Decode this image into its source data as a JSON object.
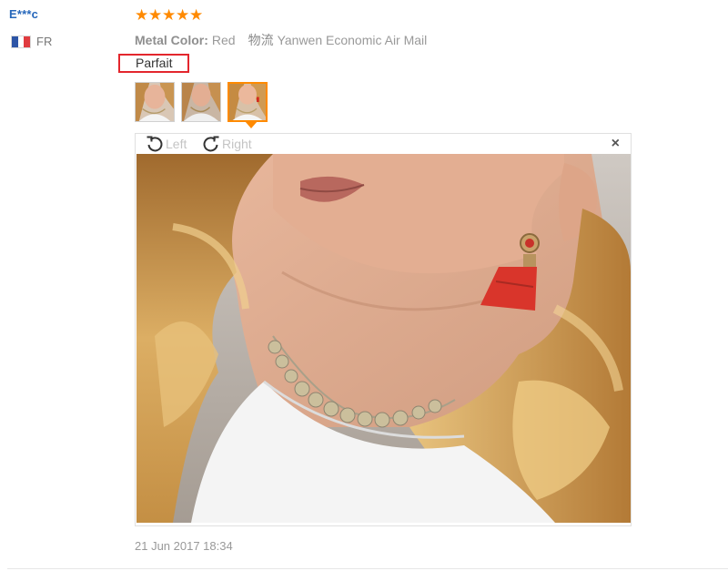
{
  "reviewer": {
    "name": "E***c",
    "country_code": "FR",
    "flag_icon": "france-flag-icon"
  },
  "review": {
    "rating_stars": 5,
    "rating_max": 5,
    "star_icon": "star-icon",
    "metal_color_label": "Metal Color:",
    "metal_color_value": "Red",
    "shipping_label": "物流",
    "shipping_value": "Yanwen Economic Air Mail",
    "feedback": "Parfait",
    "date": "21 Jun 2017 18:34"
  },
  "thumbnails": [
    {
      "name": "review-photo-thumb-1",
      "active": false
    },
    {
      "name": "review-photo-thumb-2",
      "active": false
    },
    {
      "name": "review-photo-thumb-3",
      "active": true
    }
  ],
  "viewer": {
    "rotate_left_label": "Left",
    "rotate_right_label": "Right",
    "close_label": "×",
    "rotate_left_icon": "rotate-left-icon",
    "rotate_right_icon": "rotate-right-icon",
    "close_icon": "close-icon"
  },
  "colors": {
    "accent_orange": "#ff8a00",
    "reviewer_blue": "#2566ba",
    "highlight_red": "#e3262d",
    "muted_text": "#999999"
  }
}
